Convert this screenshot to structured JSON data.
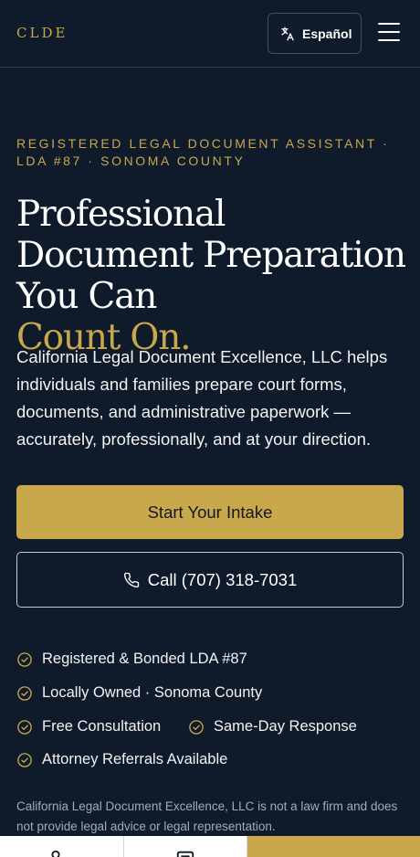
{
  "header": {
    "logo": "CLDE",
    "language_button": "Español",
    "language_icon": "translate-icon",
    "menu_icon": "hamburger-menu-icon"
  },
  "hero": {
    "eyebrow": "REGISTERED LEGAL DOCUMENT ASSISTANT · LDA #87 · SONOMA COUNTY",
    "headline_line1": "Professional Document Preparation You Can",
    "headline_accent": "Count On.",
    "lede": "California Legal Document Excellence, LLC helps individuals and families prepare court forms, documents, and administrative paperwork — accurately, professionally, and at your direction."
  },
  "actions": {
    "primary_label": "Start Your Intake",
    "call_label": "Call (707) 318-7031",
    "call_icon": "phone-icon"
  },
  "badges": [
    "Registered & Bonded LDA #87",
    "Locally Owned · Sonoma County",
    "Free Consultation",
    "Same-Day Response",
    "Attorney Referrals Available"
  ],
  "disclaimer": "California Legal Document Excellence, LLC is not a law firm and does not provide legal advice or legal representation.",
  "colors": {
    "background": "#0f1a2b",
    "accent": "#c9a84c",
    "text": "#ffffff",
    "muted": "#a5abb4"
  },
  "bottom_bar": {
    "icons": [
      "person-icon",
      "message-icon"
    ]
  }
}
